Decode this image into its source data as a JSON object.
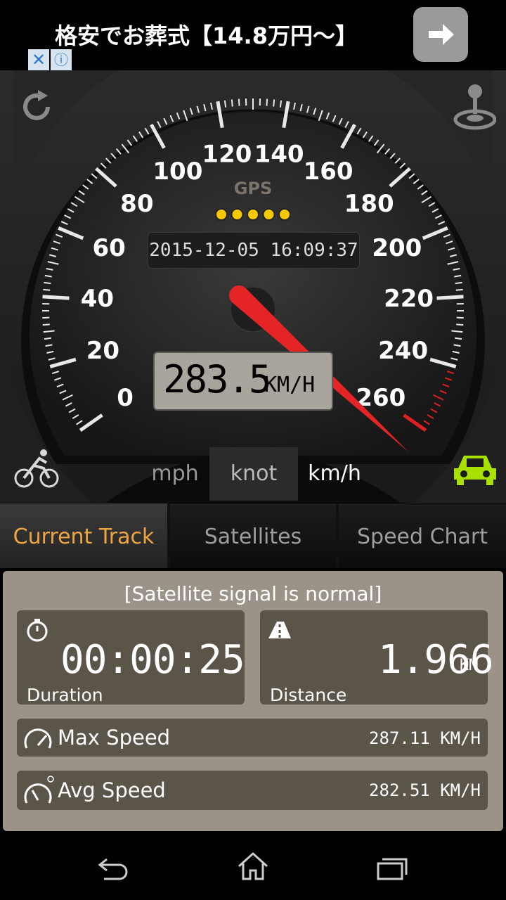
{
  "ad": {
    "text": "格安でお葬式【14.8万円〜】"
  },
  "gauge": {
    "dial_numbers": [
      "0",
      "20",
      "40",
      "60",
      "80",
      "100",
      "120",
      "140",
      "160",
      "180",
      "200",
      "220",
      "240",
      "260"
    ],
    "gps_label": "GPS",
    "gps_signal_dots": 5,
    "gps_dot_color": "#f6c800",
    "datetime": "2015-12-05 16:09:37",
    "speed_value": "283.5",
    "speed_unit": "KM/H",
    "needle_value": 283.5,
    "redline_color": "#e02020",
    "needle_color": "#e52525"
  },
  "units": {
    "mph": "mph",
    "knot": "knot",
    "kmh": "km/h",
    "selected": "km/h"
  },
  "icons": {
    "refresh": "refresh-icon",
    "joystick": "joystick-icon",
    "bike": "bicycle-icon",
    "car": "car-icon",
    "car_color": "#a8e000"
  },
  "tabs": [
    {
      "label": "Current Track",
      "active": true
    },
    {
      "label": "Satellites",
      "active": false
    },
    {
      "label": "Speed Chart",
      "active": false
    }
  ],
  "accent_color": "#f0a540",
  "track": {
    "signal_status": "[Satellite signal is normal]",
    "duration_value": "00:00:25",
    "duration_label": "Duration",
    "distance_value": "1.966",
    "distance_unit": "KM",
    "distance_label": "Distance",
    "max_speed_label": "Max Speed",
    "max_speed_value": "287.11 KM/H",
    "avg_speed_label": "Avg Speed",
    "avg_speed_value": "282.51 KM/H"
  }
}
